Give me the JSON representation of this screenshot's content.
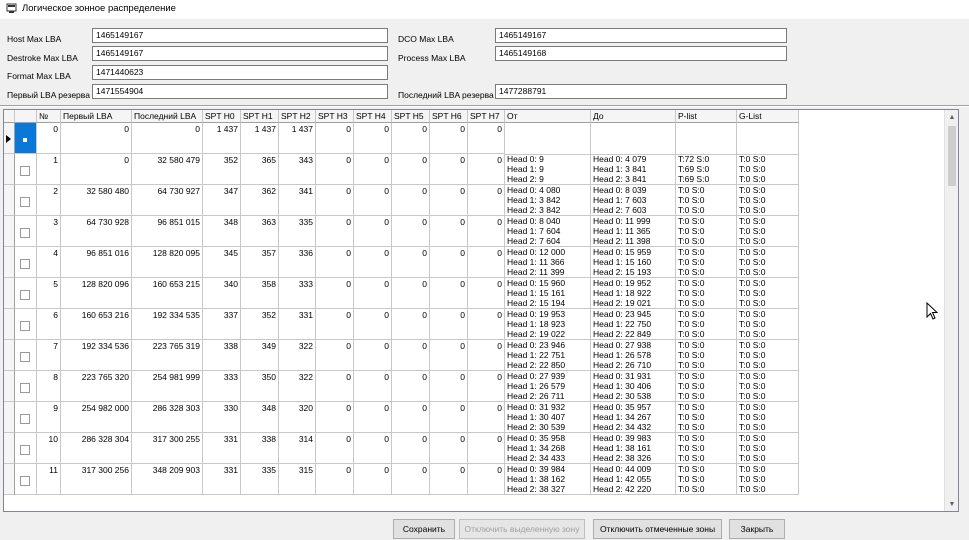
{
  "window": {
    "title": "Логическое зонное распределение",
    "icon": "app-window-icon"
  },
  "fields": {
    "host_max_lba": {
      "label": "Host Max LBA",
      "value": "1465149167"
    },
    "destroke_max_lba": {
      "label": "Destroke Max LBA",
      "value": "1465149167"
    },
    "format_max_lba": {
      "label": "Format Max LBA",
      "value": "1471440623"
    },
    "first_reserve_lba": {
      "label": "Первый LBA резерва",
      "value": "1471554904"
    },
    "dco_max_lba": {
      "label": "DCO Max LBA",
      "value": "1465149167"
    },
    "process_max_lba": {
      "label": "Process Max LBA",
      "value": "1465149168"
    },
    "last_reserve_lba": {
      "label": "Последний LBA резерва",
      "value": "1477288791"
    }
  },
  "table": {
    "columns": [
      "№",
      "Первый LBA",
      "Последний LBA",
      "SPT H0",
      "SPT H1",
      "SPT H2",
      "SPT H3",
      "SPT H4",
      "SPT H5",
      "SPT H6",
      "SPT H7",
      "От",
      "До",
      "P-list",
      "G-List"
    ],
    "rows": [
      {
        "n": "0",
        "first": "0",
        "last": "0",
        "spt": [
          "1 437",
          "1 437",
          "1 437",
          "0",
          "0",
          "0",
          "0",
          "0"
        ],
        "from": [],
        "to": [],
        "plist": [],
        "glist": [],
        "selected": true
      },
      {
        "n": "1",
        "first": "0",
        "last": "32 580 479",
        "spt": [
          "352",
          "365",
          "343",
          "0",
          "0",
          "0",
          "0",
          "0"
        ],
        "from": [
          "Head 0: 9",
          "Head 1: 9",
          "Head 2: 9"
        ],
        "to": [
          "Head 0: 4 079",
          "Head 1: 3 841",
          "Head 2: 3 841"
        ],
        "plist": [
          "T:72 S:0",
          "T:69 S:0",
          "T:69 S:0"
        ],
        "glist": [
          "T:0 S:0",
          "T:0 S:0",
          "T:0 S:0"
        ]
      },
      {
        "n": "2",
        "first": "32 580 480",
        "last": "64 730 927",
        "spt": [
          "347",
          "362",
          "341",
          "0",
          "0",
          "0",
          "0",
          "0"
        ],
        "from": [
          "Head 0: 4 080",
          "Head 1: 3 842",
          "Head 2: 3 842"
        ],
        "to": [
          "Head 0: 8 039",
          "Head 1: 7 603",
          "Head 2: 7 603"
        ],
        "plist": [
          "T:0 S:0",
          "T:0 S:0",
          "T:0 S:0"
        ],
        "glist": [
          "T:0 S:0",
          "T:0 S:0",
          "T:0 S:0"
        ]
      },
      {
        "n": "3",
        "first": "64 730 928",
        "last": "96 851 015",
        "spt": [
          "348",
          "363",
          "335",
          "0",
          "0",
          "0",
          "0",
          "0"
        ],
        "from": [
          "Head 0: 8 040",
          "Head 1: 7 604",
          "Head 2: 7 604"
        ],
        "to": [
          "Head 0: 11 999",
          "Head 1: 11 365",
          "Head 2: 11 398"
        ],
        "plist": [
          "T:0 S:0",
          "T:0 S:0",
          "T:0 S:0"
        ],
        "glist": [
          "T:0 S:0",
          "T:0 S:0",
          "T:0 S:0"
        ]
      },
      {
        "n": "4",
        "first": "96 851 016",
        "last": "128 820 095",
        "spt": [
          "345",
          "357",
          "336",
          "0",
          "0",
          "0",
          "0",
          "0"
        ],
        "from": [
          "Head 0: 12 000",
          "Head 1: 11 366",
          "Head 2: 11 399"
        ],
        "to": [
          "Head 0: 15 959",
          "Head 1: 15 160",
          "Head 2: 15 193"
        ],
        "plist": [
          "T:0 S:0",
          "T:0 S:0",
          "T:0 S:0"
        ],
        "glist": [
          "T:0 S:0",
          "T:0 S:0",
          "T:0 S:0"
        ]
      },
      {
        "n": "5",
        "first": "128 820 096",
        "last": "160 653 215",
        "spt": [
          "340",
          "358",
          "333",
          "0",
          "0",
          "0",
          "0",
          "0"
        ],
        "from": [
          "Head 0: 15 960",
          "Head 1: 15 161",
          "Head 2: 15 194"
        ],
        "to": [
          "Head 0: 19 952",
          "Head 1: 18 922",
          "Head 2: 19 021"
        ],
        "plist": [
          "T:0 S:0",
          "T:0 S:0",
          "T:0 S:0"
        ],
        "glist": [
          "T:0 S:0",
          "T:0 S:0",
          "T:0 S:0"
        ]
      },
      {
        "n": "6",
        "first": "160 653 216",
        "last": "192 334 535",
        "spt": [
          "337",
          "352",
          "331",
          "0",
          "0",
          "0",
          "0",
          "0"
        ],
        "from": [
          "Head 0: 19 953",
          "Head 1: 18 923",
          "Head 2: 19 022"
        ],
        "to": [
          "Head 0: 23 945",
          "Head 1: 22 750",
          "Head 2: 22 849"
        ],
        "plist": [
          "T:0 S:0",
          "T:0 S:0",
          "T:0 S:0"
        ],
        "glist": [
          "T:0 S:0",
          "T:0 S:0",
          "T:0 S:0"
        ]
      },
      {
        "n": "7",
        "first": "192 334 536",
        "last": "223 765 319",
        "spt": [
          "338",
          "349",
          "322",
          "0",
          "0",
          "0",
          "0",
          "0"
        ],
        "from": [
          "Head 0: 23 946",
          "Head 1: 22 751",
          "Head 2: 22 850"
        ],
        "to": [
          "Head 0: 27 938",
          "Head 1: 26 578",
          "Head 2: 26 710"
        ],
        "plist": [
          "T:0 S:0",
          "T:0 S:0",
          "T:0 S:0"
        ],
        "glist": [
          "T:0 S:0",
          "T:0 S:0",
          "T:0 S:0"
        ]
      },
      {
        "n": "8",
        "first": "223 765 320",
        "last": "254 981 999",
        "spt": [
          "333",
          "350",
          "322",
          "0",
          "0",
          "0",
          "0",
          "0"
        ],
        "from": [
          "Head 0: 27 939",
          "Head 1: 26 579",
          "Head 2: 26 711"
        ],
        "to": [
          "Head 0: 31 931",
          "Head 1: 30 406",
          "Head 2: 30 538"
        ],
        "plist": [
          "T:0 S:0",
          "T:0 S:0",
          "T:0 S:0"
        ],
        "glist": [
          "T:0 S:0",
          "T:0 S:0",
          "T:0 S:0"
        ]
      },
      {
        "n": "9",
        "first": "254 982 000",
        "last": "286 328 303",
        "spt": [
          "330",
          "348",
          "320",
          "0",
          "0",
          "0",
          "0",
          "0"
        ],
        "from": [
          "Head 0: 31 932",
          "Head 1: 30 407",
          "Head 2: 30 539"
        ],
        "to": [
          "Head 0: 35 957",
          "Head 1: 34 267",
          "Head 2: 34 432"
        ],
        "plist": [
          "T:0 S:0",
          "T:0 S:0",
          "T:0 S:0"
        ],
        "glist": [
          "T:0 S:0",
          "T:0 S:0",
          "T:0 S:0"
        ]
      },
      {
        "n": "10",
        "first": "286 328 304",
        "last": "317 300 255",
        "spt": [
          "331",
          "338",
          "314",
          "0",
          "0",
          "0",
          "0",
          "0"
        ],
        "from": [
          "Head 0: 35 958",
          "Head 1: 34 268",
          "Head 2: 34 433"
        ],
        "to": [
          "Head 0: 39 983",
          "Head 1: 38 161",
          "Head 2: 38 326"
        ],
        "plist": [
          "T:0 S:0",
          "T:0 S:0",
          "T:0 S:0"
        ],
        "glist": [
          "T:0 S:0",
          "T:0 S:0",
          "T:0 S:0"
        ]
      },
      {
        "n": "11",
        "first": "317 300 256",
        "last": "348 209 903",
        "spt": [
          "331",
          "335",
          "315",
          "0",
          "0",
          "0",
          "0",
          "0"
        ],
        "from": [
          "Head 0: 39 984",
          "Head 1: 38 162",
          "Head 2: 38 327"
        ],
        "to": [
          "Head 0: 44 009",
          "Head 1: 42 055",
          "Head 2: 42 220"
        ],
        "plist": [
          "T:0 S:0",
          "T:0 S:0",
          "T:0 S:0"
        ],
        "glist": [
          "T:0 S:0",
          "T:0 S:0",
          "T:0 S:0"
        ]
      }
    ]
  },
  "buttons": {
    "save": "Сохранить",
    "disable_selected": "Отключить выделенную зону",
    "disable_checked": "Отключить отмеченные зоны",
    "close": "Закрыть"
  },
  "colors": {
    "selection": "#0a78d7",
    "window_bg": "#f0f0f0"
  }
}
